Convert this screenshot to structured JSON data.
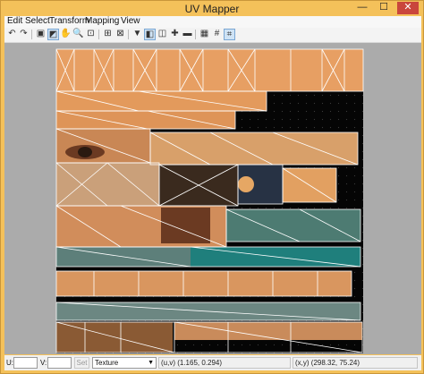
{
  "window": {
    "title": "UV Mapper",
    "minimize_glyph": "—",
    "maximize_glyph": "☐",
    "close_glyph": "✕"
  },
  "menu": {
    "items": [
      "Edit",
      "Select",
      "Transform",
      "Mapping",
      "View"
    ]
  },
  "toolbar": {
    "tools": [
      {
        "name": "undo-icon",
        "glyph": "↶"
      },
      {
        "name": "redo-icon",
        "glyph": "↷"
      },
      {
        "name": "select-tool-icon",
        "glyph": "▣"
      },
      {
        "name": "paint-select-icon",
        "glyph": "◩"
      },
      {
        "name": "hand-tool-icon",
        "glyph": "✋"
      },
      {
        "name": "zoom-tool-icon",
        "glyph": "🔍"
      },
      {
        "name": "zoom-fit-icon",
        "glyph": "⊡"
      },
      {
        "name": "grid-select-icon",
        "glyph": "⊞"
      },
      {
        "name": "snap-toggle-icon",
        "glyph": "⊠"
      },
      {
        "name": "filter-icon",
        "glyph": "▼"
      },
      {
        "name": "split-view-icon",
        "glyph": "◧"
      },
      {
        "name": "mirror-icon",
        "glyph": "◫"
      },
      {
        "name": "add-icon",
        "glyph": "✚"
      },
      {
        "name": "remove-icon",
        "glyph": "▬"
      },
      {
        "name": "show-grid-icon",
        "glyph": "▦"
      },
      {
        "name": "grid-density-icon",
        "glyph": "#"
      },
      {
        "name": "snap-grid-icon",
        "glyph": "⌗"
      }
    ]
  },
  "status": {
    "u_label": "U:",
    "u_value": "",
    "v_label": "V:",
    "v_value": "",
    "set_label": "Set",
    "mode_value": "Texture",
    "uv_readout": "(u,v) (1.165, 0.294)",
    "xy_readout": "(x,y) (298.32, 75.24)"
  },
  "colors": {
    "title_bar": "#f4c15a",
    "canvas_background": "#ababab",
    "texture_black": "#050505",
    "mesh_lines": "#ffffff"
  }
}
